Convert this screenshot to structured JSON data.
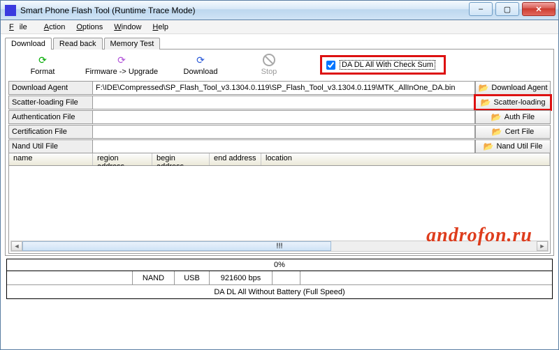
{
  "window": {
    "title": "Smart Phone Flash Tool (Runtime Trace Mode)"
  },
  "menu": {
    "file": "File",
    "action": "Action",
    "options": "Options",
    "window": "Window",
    "help": "Help"
  },
  "tabs": {
    "download": "Download",
    "readback": "Read back",
    "memtest": "Memory Test"
  },
  "toolbar": {
    "format": "Format",
    "upgrade": "Firmware -> Upgrade",
    "download": "Download",
    "stop": "Stop",
    "check_label": "DA DL All With Check Sum"
  },
  "files": {
    "agent_label": "Download Agent",
    "agent_value": "F:\\IDE\\Compressed\\SP_Flash_Tool_v3.1304.0.119\\SP_Flash_Tool_v3.1304.0.119\\MTK_AllInOne_DA.bin",
    "agent_btn": "Download Agent",
    "scatter_label": "Scatter-loading File",
    "scatter_value": "",
    "scatter_btn": "Scatter-loading",
    "auth_label": "Authentication File",
    "auth_value": "",
    "auth_btn": "Auth File",
    "cert_label": "Certification File",
    "cert_value": "",
    "cert_btn": "Cert File",
    "nand_label": "Nand Util File",
    "nand_value": "",
    "nand_btn": "Nand Util File"
  },
  "columns": {
    "name": "name",
    "region": "region address",
    "begin": "begin address",
    "end": "end address",
    "location": "location"
  },
  "scroll_mid": "!!!",
  "progress": "0%",
  "status": {
    "nand": "NAND",
    "usb": "USB",
    "baud": "921600 bps",
    "mode": "DA DL All Without Battery (Full Speed)"
  },
  "watermark": "androfon.ru"
}
